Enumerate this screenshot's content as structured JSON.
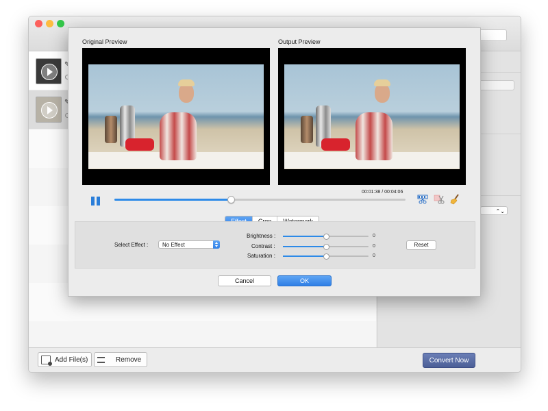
{
  "window": {
    "traffic_lights": [
      "#fc605c",
      "#fdbc40",
      "#34c84a"
    ]
  },
  "bottom_bar": {
    "add_files_label": "Add File(s)",
    "remove_label": "Remove",
    "convert_label": "Convert Now"
  },
  "dialog": {
    "original_title": "Original Preview",
    "output_title": "Output Preview",
    "playback": {
      "elapsed": "00:01:38",
      "total": "00:04:06",
      "timecode": "00:01:38 / 00:04:06",
      "progress": 0.4
    },
    "tools": [
      "filmstrip-cut-icon",
      "scissors-icon",
      "broom-icon"
    ],
    "tabs": [
      {
        "label": "Effect",
        "active": true
      },
      {
        "label": "Crop",
        "active": false
      },
      {
        "label": "Watermark",
        "active": false
      }
    ],
    "effect": {
      "select_label": "Select Effect :",
      "select_value": "No Effect",
      "sliders": [
        {
          "label": "Brightness :",
          "value": "0",
          "position": 0.5
        },
        {
          "label": "Contrast :",
          "value": "0",
          "position": 0.5
        },
        {
          "label": "Saturation :",
          "value": "0",
          "position": 0.5
        }
      ],
      "reset_label": "Reset"
    },
    "cancel_label": "Cancel",
    "ok_label": "OK"
  },
  "colors": {
    "accent": "#2d8ae8",
    "convert_button": "#546aa3"
  }
}
